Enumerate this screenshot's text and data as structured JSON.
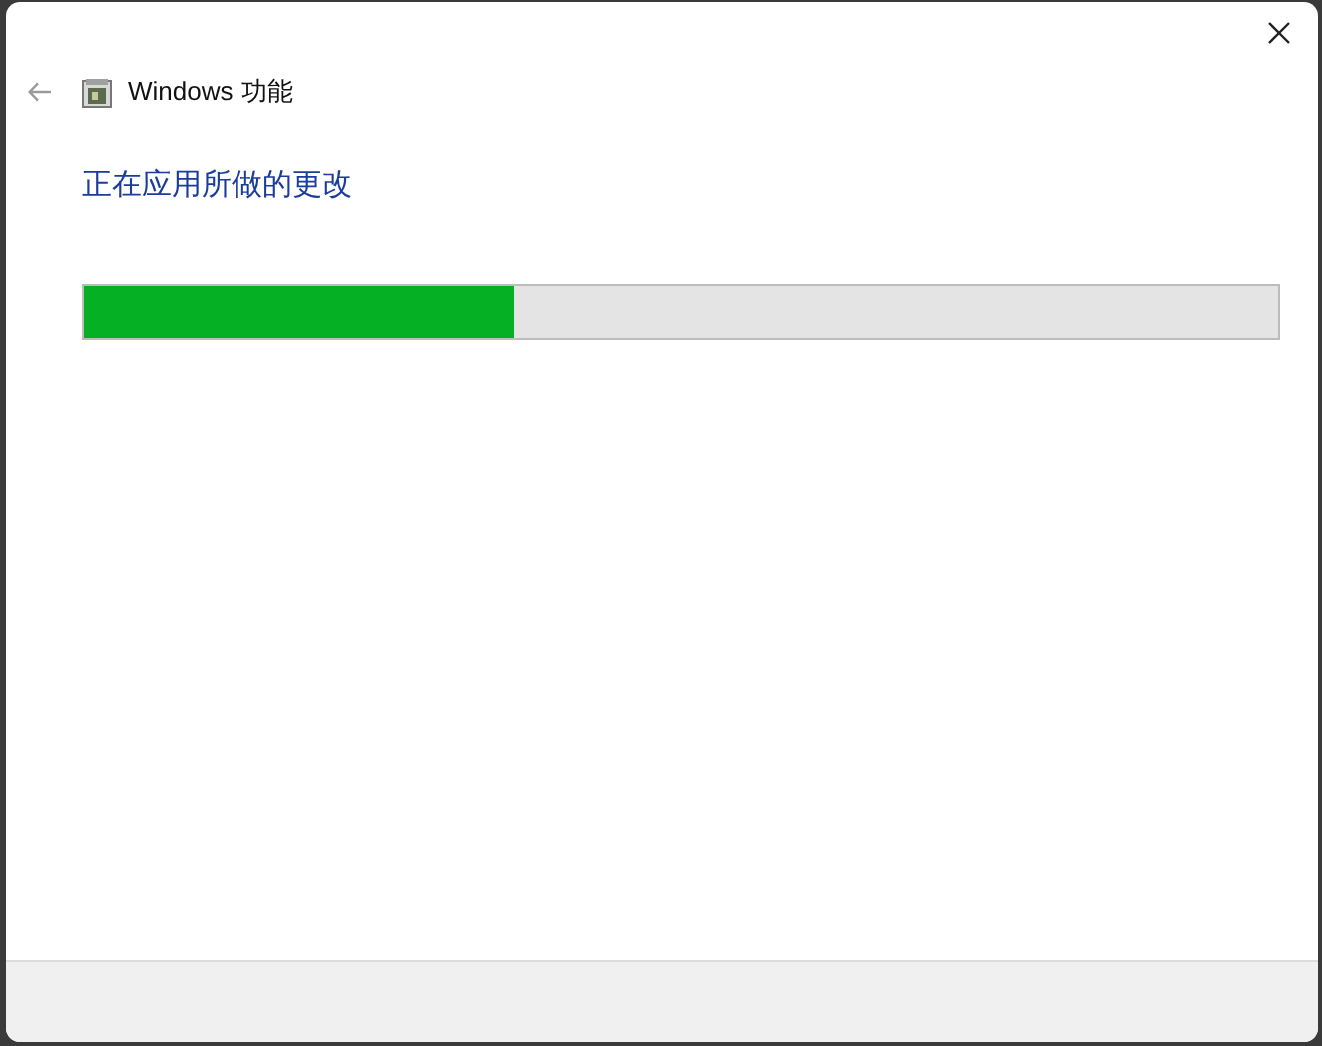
{
  "window": {
    "title": "Windows 功能"
  },
  "heading": "正在应用所做的更改",
  "progress": {
    "level": 0.36
  }
}
